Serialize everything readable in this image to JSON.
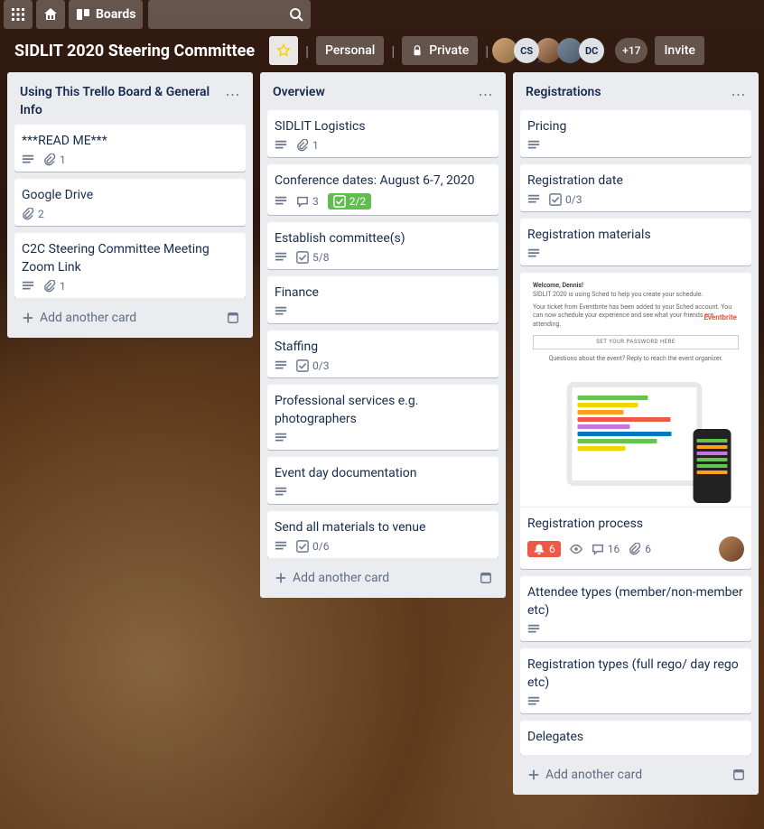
{
  "topbar": {
    "boards_label": "Boards"
  },
  "header": {
    "board_name": "SIDLIT 2020 Steering Committee",
    "personal_label": "Personal",
    "private_label": "Private",
    "invite_label": "Invite",
    "avatars": [
      {
        "type": "img",
        "cls": "img1"
      },
      {
        "type": "init",
        "text": "CS",
        "admin": true
      },
      {
        "type": "img",
        "cls": "img2"
      },
      {
        "type": "img",
        "cls": "img3"
      },
      {
        "type": "init",
        "text": "DC"
      }
    ],
    "more_avatars": "+17"
  },
  "lists": [
    {
      "id": "using",
      "name": "Using This Trello Board & General Info",
      "cards": [
        {
          "title": "***READ ME***",
          "badges": {
            "desc": true,
            "attachments": "1"
          }
        },
        {
          "title": "Google Drive",
          "badges": {
            "attachments": "2"
          }
        },
        {
          "title": "C2C Steering Committee Meeting Zoom Link",
          "badges": {
            "desc": true,
            "attachments": "1"
          }
        }
      ]
    },
    {
      "id": "overview",
      "name": "Overview",
      "cards": [
        {
          "title": "SIDLIT Logistics",
          "badges": {
            "desc": true,
            "attachments": "1"
          }
        },
        {
          "title": "Conference dates: August 6-7, 2020",
          "badges": {
            "desc": true,
            "comments": "3",
            "checklist": "2/2",
            "checklist_done": true
          }
        },
        {
          "title": "Establish committee(s)",
          "badges": {
            "desc": true,
            "checklist": "5/8"
          }
        },
        {
          "title": "Finance",
          "badges": {
            "desc": true
          }
        },
        {
          "title": "Staffing",
          "badges": {
            "desc": true,
            "checklist": "0/3"
          }
        },
        {
          "title": "Professional services e.g. photographers",
          "badges": {
            "desc": true
          }
        },
        {
          "title": "Event day documentation",
          "badges": {
            "desc": true
          }
        },
        {
          "title": "Send all materials to venue",
          "badges": {
            "desc": true,
            "checklist": "0/6"
          }
        }
      ]
    },
    {
      "id": "registrations",
      "name": "Registrations",
      "cards": [
        {
          "title": "Pricing",
          "badges": {
            "desc": true
          }
        },
        {
          "title": "Registration date",
          "badges": {
            "desc": true,
            "checklist": "0/3"
          }
        },
        {
          "title": "Registration materials",
          "badges": {
            "desc": true
          }
        },
        {
          "title": "Registration process",
          "cover": true,
          "badges": {
            "notify": "6",
            "watch": true,
            "comments": "16",
            "attachments": "6",
            "member": true
          }
        },
        {
          "title": "Attendee types (member/non-member etc)",
          "badges": {
            "desc": true
          }
        },
        {
          "title": "Registration types (full rego/ day rego etc)",
          "badges": {
            "desc": true
          }
        },
        {
          "title": "Delegates"
        }
      ]
    }
  ],
  "add_card_label": "Add another card",
  "cover_text": {
    "welcome": "Welcome, Dennis!",
    "line1": "SIDLIT 2020 is using Sched to help you create your schedule.",
    "line2": "Your ticket from Eventbrite has been added to your Sched account. You can now schedule your experience and see what your friends are attending.",
    "brand": "Eventbrite",
    "pwbtn": "SET YOUR PASSWORD HERE",
    "footer": "Questions about the event? Reply to reach the event organizer."
  }
}
